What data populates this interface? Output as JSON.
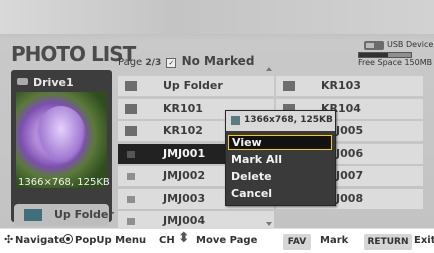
{
  "header": {
    "title": "PHOTO LIST",
    "page_prefix": "Page",
    "page_value": "2/3",
    "marked_status": "No Marked",
    "usb_label": "USB Device",
    "free_space": "Free Space 150MB",
    "usb_used_fraction": 0.55
  },
  "left_panel": {
    "drive": "Drive1",
    "resolution": "1366×768, 125KB",
    "up_folder_button": "Up Folder"
  },
  "list": {
    "left_column": [
      {
        "label": "Up Folder",
        "icon": "folder-up-icon"
      },
      {
        "label": "KR101",
        "icon": "folder-icon"
      },
      {
        "label": "KR102",
        "icon": "folder-icon"
      },
      {
        "label": "JMJ001",
        "icon": "photo-icon",
        "selected": true
      },
      {
        "label": "JMJ002",
        "icon": "photo-icon"
      },
      {
        "label": "JMJ003",
        "icon": "photo-icon"
      },
      {
        "label": "JMJ004",
        "icon": "photo-icon"
      }
    ],
    "right_column": [
      {
        "label": "KR103",
        "icon": "folder-icon"
      },
      {
        "label": "KR104",
        "icon": "folder-icon"
      },
      {
        "label": "JMJ005",
        "icon": "photo-icon"
      },
      {
        "label": "JMJ006",
        "icon": "photo-icon"
      },
      {
        "label": "JMJ007",
        "icon": "photo-icon"
      },
      {
        "label": "JMJ008",
        "icon": "photo-icon"
      }
    ]
  },
  "popup": {
    "header": "1366x768, 125KB",
    "items": [
      "View",
      "Mark All",
      "Delete",
      "Cancel"
    ],
    "active_index": 0
  },
  "footer": {
    "navigate": "Navigate",
    "popup_menu": "PopUp Menu",
    "ch": "CH",
    "move_page": "Move Page",
    "fav": "FAV",
    "mark": "Mark",
    "return": "RETURN",
    "exit": "Exit"
  },
  "colors": {
    "selection_border": "#ffcc00",
    "selected_row": "#222222",
    "row_bg": "#dcdcdc"
  }
}
